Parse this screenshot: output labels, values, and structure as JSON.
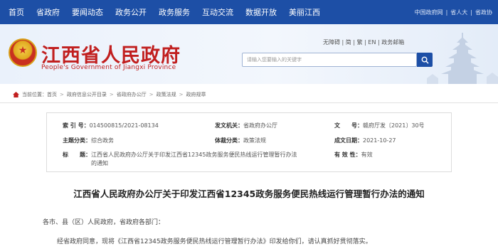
{
  "topnav": {
    "items": [
      "首页",
      "省政府",
      "要闻动态",
      "政务公开",
      "政务服务",
      "互动交流",
      "数据开放",
      "美丽江西"
    ],
    "links": [
      "中国政府网",
      "省人大",
      "省政协"
    ]
  },
  "banner": {
    "title": "江西省人民政府",
    "subtitle": "People's Government of Jiangxi Province",
    "lang_links": [
      "无障碍",
      "简",
      "繁",
      "EN",
      "政务邮箱"
    ],
    "search_placeholder": "请输入您要输入的关键字"
  },
  "breadcrumb": {
    "label": "当前位置：",
    "items": [
      "首页",
      "政府信息公开目录",
      "省政府办公厅",
      "政策法规",
      "政府规章"
    ]
  },
  "info": {
    "index_label": "索 引 号：",
    "index_value": "014500815/2021-08134",
    "issuer_label": "发文机关：",
    "issuer_value": "省政府办公厅",
    "docno_label": "文　　号：",
    "docno_value": "赣府厅发〔2021〕30号",
    "category_label": "主题分类：",
    "category_value": "综合政务",
    "type_label": "体裁分类：",
    "type_value": "政策法规",
    "date_label": "成文日期：",
    "date_value": "2021-10-27",
    "title_label": "标　　题：",
    "title_value_1": "江西省人民政府办公厅关于印发江西省12345政务服务便民热线运行管理暂行办法",
    "title_value_2": "的通知",
    "validity_label": "有 效 性：",
    "validity_value": "有效"
  },
  "document": {
    "title": "江西省人民政府办公厅关于印发江西省12345政务服务便民热线运行管理暂行办法的通知",
    "greeting": "各市、县（区）人民政府，省政府各部门：",
    "paragraph": "经省政府同意，现将《江西省12345政务服务便民热线运行管理暂行办法》印发给你们，请认真抓好贯彻落实。"
  },
  "colors": {
    "nav_bg": "#1d4fa6",
    "title_red": "#c11f1f"
  }
}
